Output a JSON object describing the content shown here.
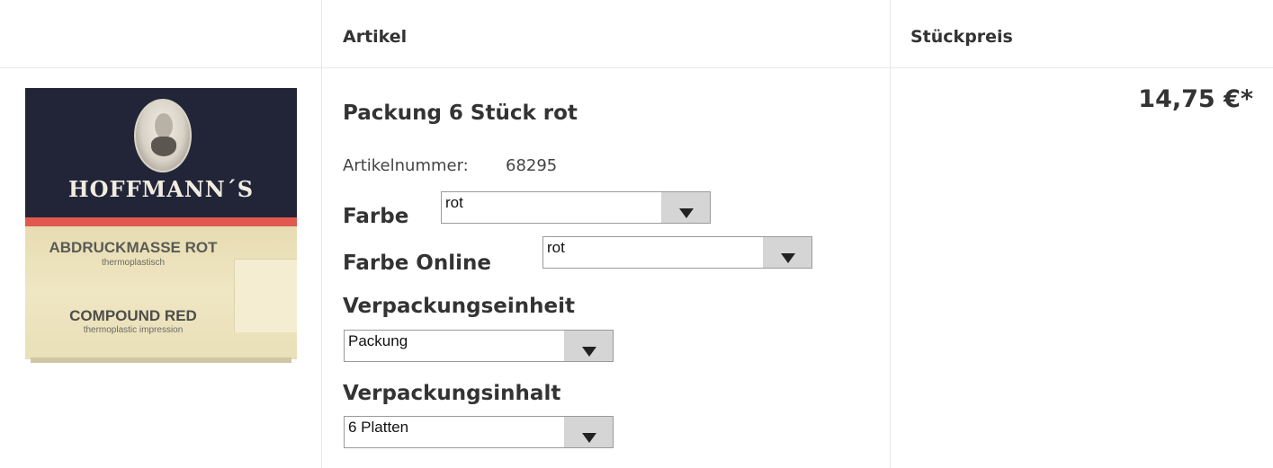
{
  "table": {
    "headers": {
      "artikel": "Artikel",
      "stueckpreis": "Stückpreis"
    }
  },
  "product": {
    "image": {
      "brand": "HOFFMANN´S",
      "line1": "ABDRUCKMASSE ROT",
      "line2": "thermoplastisch",
      "line3": "COMPOUND RED",
      "line4": "thermoplastic impression",
      "colors": {
        "top": "#222538",
        "stripe": "#e0584f",
        "bottom": "#e9dfb8"
      }
    },
    "title": "Packung 6 Stück rot",
    "article_number_label": "Artikelnummer:",
    "article_number": "68295",
    "options": {
      "farbe": {
        "label": "Farbe",
        "value": "rot"
      },
      "farbe_online": {
        "label": "Farbe Online",
        "value": "rot"
      },
      "verpackungseinheit": {
        "label": "Verpackungseinheit",
        "value": "Packung"
      },
      "verpackungsinhalt": {
        "label": "Verpackungsinhalt",
        "value": "6 Platten"
      }
    },
    "price": "14,75 €*"
  }
}
